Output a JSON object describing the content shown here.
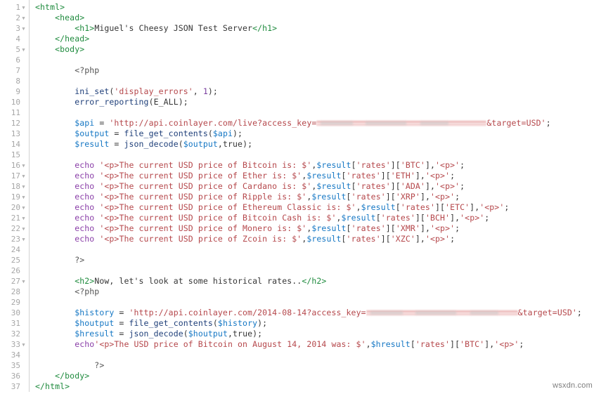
{
  "editor": {
    "watermark": "wsxdn.com",
    "language": "php-html",
    "total_lines": 37,
    "colors": {
      "background": "#ffffff",
      "gutter_text": "#a6a6a6",
      "gutter_border": "#d2d2d2",
      "html_tag": "#1f8b3e",
      "variable": "#1577c4",
      "string": "#b5474b",
      "function": "#20407a",
      "keyword": "#8a3fa8",
      "number": "#7a3fa0",
      "plain_text": "#353535"
    },
    "redacted_label": "access_key value redacted"
  },
  "lines": [
    {
      "n": 1,
      "fold": true,
      "indent": 0,
      "text": "<html>"
    },
    {
      "n": 2,
      "fold": true,
      "indent": 1,
      "text": "<head>"
    },
    {
      "n": 3,
      "fold": true,
      "indent": 2,
      "text": "<h1>Miguel's Cheesy JSON Test Server</h1>"
    },
    {
      "n": 4,
      "fold": false,
      "indent": 1,
      "text": "</head>"
    },
    {
      "n": 5,
      "fold": true,
      "indent": 1,
      "text": "<body>"
    },
    {
      "n": 6,
      "fold": false,
      "indent": 0,
      "text": ""
    },
    {
      "n": 7,
      "fold": false,
      "indent": 2,
      "text": "<?php"
    },
    {
      "n": 8,
      "fold": false,
      "indent": 0,
      "text": ""
    },
    {
      "n": 9,
      "fold": false,
      "indent": 2,
      "text": "ini_set('display_errors', 1);"
    },
    {
      "n": 10,
      "fold": false,
      "indent": 2,
      "text": "error_reporting(E_ALL);"
    },
    {
      "n": 11,
      "fold": false,
      "indent": 0,
      "text": ""
    },
    {
      "n": 12,
      "fold": false,
      "indent": 2,
      "text": "$api = 'http://api.coinlayer.com/live?access_key=████████&target=USD';"
    },
    {
      "n": 13,
      "fold": false,
      "indent": 2,
      "text": "$output = file_get_contents($api);"
    },
    {
      "n": 14,
      "fold": false,
      "indent": 2,
      "text": "$result = json_decode($output,true);"
    },
    {
      "n": 15,
      "fold": false,
      "indent": 0,
      "text": ""
    },
    {
      "n": 16,
      "fold": true,
      "indent": 2,
      "text": "echo '<p>The current USD price of Bitcoin is: $',$result['rates']['BTC'],'<p>';"
    },
    {
      "n": 17,
      "fold": true,
      "indent": 2,
      "text": "echo '<p>The current USD price of Ether is: $',$result['rates']['ETH'],'<p>';"
    },
    {
      "n": 18,
      "fold": true,
      "indent": 2,
      "text": "echo '<p>The current USD price of Cardano is: $',$result['rates']['ADA'],'<p>';"
    },
    {
      "n": 19,
      "fold": true,
      "indent": 2,
      "text": "echo '<p>The current USD price of Ripple is: $',$result['rates']['XRP'],'<p>';"
    },
    {
      "n": 20,
      "fold": true,
      "indent": 2,
      "text": "echo '<p>The current USD price of Ethereum Classic is: $',$result['rates']['ETC'],'<p>';"
    },
    {
      "n": 21,
      "fold": true,
      "indent": 2,
      "text": "echo '<p>The current USD price of Bitcoin Cash is: $',$result['rates']['BCH'],'<p>';"
    },
    {
      "n": 22,
      "fold": true,
      "indent": 2,
      "text": "echo '<p>The current USD price of Monero is: $',$result['rates']['XMR'],'<p>';"
    },
    {
      "n": 23,
      "fold": true,
      "indent": 2,
      "text": "echo '<p>The current USD price of Zcoin is: $',$result['rates']['XZC'],'<p>';"
    },
    {
      "n": 24,
      "fold": false,
      "indent": 0,
      "text": ""
    },
    {
      "n": 25,
      "fold": false,
      "indent": 2,
      "text": "?>"
    },
    {
      "n": 26,
      "fold": false,
      "indent": 0,
      "text": ""
    },
    {
      "n": 27,
      "fold": true,
      "indent": 2,
      "text": "<h2>Now, let's look at some historical rates..</h2>"
    },
    {
      "n": 28,
      "fold": false,
      "indent": 2,
      "text": "<?php"
    },
    {
      "n": 29,
      "fold": false,
      "indent": 0,
      "text": ""
    },
    {
      "n": 30,
      "fold": false,
      "indent": 2,
      "text": "$history = 'http://api.coinlayer.com/2014-08-14?access_key=████████&target=USD';"
    },
    {
      "n": 31,
      "fold": false,
      "indent": 2,
      "text": "$houtput = file_get_contents($history);"
    },
    {
      "n": 32,
      "fold": false,
      "indent": 2,
      "text": "$hresult = json_decode($houtput,true);"
    },
    {
      "n": 33,
      "fold": true,
      "indent": 2,
      "text": "echo'<p>The USD price of Bitcoin on August 14, 2014 was: $',$hresult['rates']['BTC'],'<p>';"
    },
    {
      "n": 34,
      "fold": false,
      "indent": 0,
      "text": ""
    },
    {
      "n": 35,
      "fold": false,
      "indent": 3,
      "text": "?>"
    },
    {
      "n": 36,
      "fold": false,
      "indent": 1,
      "text": "</body>"
    },
    {
      "n": 37,
      "fold": false,
      "indent": 0,
      "text": "</html>"
    }
  ],
  "code_tokens": {
    "l1": [
      [
        "tag",
        "<html>"
      ]
    ],
    "l2": [
      [
        "sp",
        "    "
      ],
      [
        "tag",
        "<head>"
      ]
    ],
    "l3": [
      [
        "sp",
        "        "
      ],
      [
        "tag",
        "<h1>"
      ],
      [
        "txt",
        "Miguel's Cheesy JSON Test Server"
      ],
      [
        "tag",
        "</h1>"
      ]
    ],
    "l4": [
      [
        "sp",
        "    "
      ],
      [
        "tag",
        "</head>"
      ]
    ],
    "l5": [
      [
        "sp",
        "    "
      ],
      [
        "tag",
        "<body>"
      ]
    ],
    "l7": [
      [
        "sp",
        "        "
      ],
      [
        "php",
        "<?php"
      ]
    ],
    "l9": [
      [
        "sp",
        "        "
      ],
      [
        "fn",
        "ini_set"
      ],
      [
        "punc",
        "("
      ],
      [
        "str",
        "'display_errors'"
      ],
      [
        "punc",
        ", "
      ],
      [
        "num",
        "1"
      ],
      [
        "punc",
        ");"
      ]
    ],
    "l10": [
      [
        "sp",
        "        "
      ],
      [
        "fn",
        "error_reporting"
      ],
      [
        "punc",
        "("
      ],
      [
        "const",
        "E_ALL"
      ],
      [
        "punc",
        ");"
      ]
    ],
    "l12": [
      [
        "sp",
        "        "
      ],
      [
        "var",
        "$api"
      ],
      [
        "op",
        " = "
      ],
      [
        "str",
        "'http://api.coinlayer.com/live?access_key="
      ],
      [
        "redact",
        ""
      ],
      [
        "str",
        "&target=USD'"
      ],
      [
        "punc",
        ";"
      ]
    ],
    "l13": [
      [
        "sp",
        "        "
      ],
      [
        "var",
        "$output"
      ],
      [
        "op",
        " = "
      ],
      [
        "fn",
        "file_get_contents"
      ],
      [
        "punc",
        "("
      ],
      [
        "var",
        "$api"
      ],
      [
        "punc",
        ");"
      ]
    ],
    "l14": [
      [
        "sp",
        "        "
      ],
      [
        "var",
        "$result"
      ],
      [
        "op",
        " = "
      ],
      [
        "fn",
        "json_decode"
      ],
      [
        "punc",
        "("
      ],
      [
        "var",
        "$output"
      ],
      [
        "punc",
        ","
      ],
      [
        "const",
        "true"
      ],
      [
        "punc",
        ");"
      ]
    ],
    "l25": [
      [
        "sp",
        "        "
      ],
      [
        "php",
        "?>"
      ]
    ],
    "l27": [
      [
        "sp",
        "        "
      ],
      [
        "tag",
        "<h2>"
      ],
      [
        "txt",
        "Now, let's look at some historical rates.."
      ],
      [
        "tag",
        "</h2>"
      ]
    ],
    "l28": [
      [
        "sp",
        "        "
      ],
      [
        "php",
        "<?php"
      ]
    ],
    "l30": [
      [
        "sp",
        "        "
      ],
      [
        "var",
        "$history"
      ],
      [
        "op",
        " = "
      ],
      [
        "str",
        "'http://api.coinlayer.com/2014-08-14?access_key="
      ],
      [
        "redact",
        ""
      ],
      [
        "str",
        "&target=USD'"
      ],
      [
        "punc",
        ";"
      ]
    ],
    "l31": [
      [
        "sp",
        "        "
      ],
      [
        "var",
        "$houtput"
      ],
      [
        "op",
        " = "
      ],
      [
        "fn",
        "file_get_contents"
      ],
      [
        "punc",
        "("
      ],
      [
        "var",
        "$history"
      ],
      [
        "punc",
        ");"
      ]
    ],
    "l32": [
      [
        "sp",
        "        "
      ],
      [
        "var",
        "$hresult"
      ],
      [
        "op",
        " = "
      ],
      [
        "fn",
        "json_decode"
      ],
      [
        "punc",
        "("
      ],
      [
        "var",
        "$houtput"
      ],
      [
        "punc",
        ","
      ],
      [
        "const",
        "true"
      ],
      [
        "punc",
        ");"
      ]
    ],
    "l35": [
      [
        "sp",
        "            "
      ],
      [
        "php",
        "?>"
      ]
    ],
    "l36": [
      [
        "sp",
        "    "
      ],
      [
        "tag",
        "</body>"
      ]
    ],
    "l37": [
      [
        "tag",
        "</html>"
      ]
    ]
  },
  "echo_lines": [
    {
      "line": 16,
      "coin": "Bitcoin",
      "symbol": "BTC",
      "prefix": "echo '<p>The current USD price of ",
      "mid": " is: $',",
      "var": "$result"
    },
    {
      "line": 17,
      "coin": "Ether",
      "symbol": "ETH",
      "prefix": "echo '<p>The current USD price of ",
      "mid": " is: $',",
      "var": "$result"
    },
    {
      "line": 18,
      "coin": "Cardano",
      "symbol": "ADA",
      "prefix": "echo '<p>The current USD price of ",
      "mid": " is: $',",
      "var": "$result"
    },
    {
      "line": 19,
      "coin": "Ripple",
      "symbol": "XRP",
      "prefix": "echo '<p>The current USD price of ",
      "mid": " is: $',",
      "var": "$result"
    },
    {
      "line": 20,
      "coin": "Ethereum Classic",
      "symbol": "ETC",
      "prefix": "echo '<p>The current USD price of ",
      "mid": " is: $',",
      "var": "$result"
    },
    {
      "line": 21,
      "coin": "Bitcoin Cash",
      "symbol": "BCH",
      "prefix": "echo '<p>The current USD price of ",
      "mid": " is: $',",
      "var": "$result"
    },
    {
      "line": 22,
      "coin": "Monero",
      "symbol": "XMR",
      "prefix": "echo '<p>The current USD price of ",
      "mid": " is: $',",
      "var": "$result"
    },
    {
      "line": 23,
      "coin": "Zcoin",
      "symbol": "XZC",
      "prefix": "echo '<p>The current USD price of ",
      "mid": " is: $',",
      "var": "$result"
    }
  ],
  "history_echo": {
    "line": 33,
    "prefix": "echo'<p>The USD price of Bitcoin on August 14, 2014 was: $',",
    "var": "$hresult",
    "symbol": "BTC"
  }
}
